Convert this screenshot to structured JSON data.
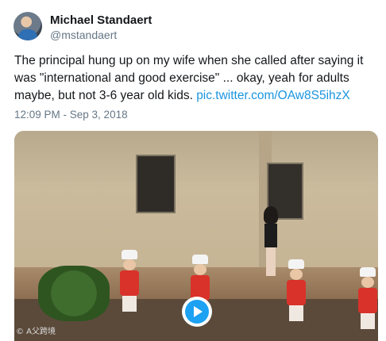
{
  "tweet": {
    "author_name": "Michael Standaert",
    "author_handle": "@mstandaert",
    "text": "The principal hung up on my wife when she called after saying it was \"international and good exercise\" ... okay, yeah for adults maybe, but not 3-6 year old kids. ",
    "link": "pic.twitter.com/OAw8S5ihzX",
    "timestamp": "12:09 PM - Sep 3, 2018"
  },
  "media": {
    "type": "video",
    "watermark": "© A父跨境",
    "play_icon": "play-icon",
    "play_color": "#1da1f2"
  },
  "colors": {
    "link": "#1b95e0",
    "secondary_text": "#657786"
  }
}
